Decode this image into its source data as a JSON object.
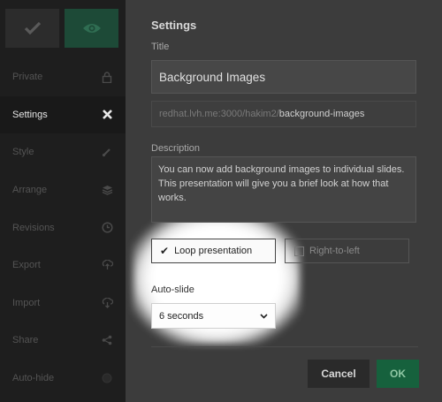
{
  "sidebar": {
    "top_buttons": {
      "check_icon": "checkmark-icon",
      "view_icon": "eye-icon"
    },
    "items": [
      {
        "label": "Private",
        "icon": "lock-icon"
      },
      {
        "label": "Settings",
        "icon": "close-icon",
        "active": true
      },
      {
        "label": "Style",
        "icon": "brush-icon"
      },
      {
        "label": "Arrange",
        "icon": "stack-icon"
      },
      {
        "label": "Revisions",
        "icon": "clock-icon"
      },
      {
        "label": "Export",
        "icon": "export-icon"
      },
      {
        "label": "Import",
        "icon": "import-icon"
      },
      {
        "label": "Share",
        "icon": "share-icon"
      },
      {
        "label": "Auto-hide",
        "icon": "toggle-icon"
      }
    ]
  },
  "settings": {
    "heading": "Settings",
    "title_label": "Title",
    "title_value": "Background Images",
    "url_prefix": "redhat.lvh.me:3000/hakim2/",
    "url_slug": "background-images",
    "description_label": "Description",
    "description_value": "You can now add background images to individual slides. This presentation will give you a brief look at how that works.",
    "loop_label": "Loop presentation",
    "loop_checked": true,
    "rtl_label": "Right-to-left",
    "rtl_checked": false,
    "autoslide_label": "Auto-slide",
    "autoslide_value": "6 seconds"
  },
  "footer": {
    "cancel_label": "Cancel",
    "ok_label": "OK"
  },
  "colors": {
    "accent": "#16613d",
    "sidebar_bg": "#1e1e1e",
    "panel_bg": "#3c3c3c"
  }
}
